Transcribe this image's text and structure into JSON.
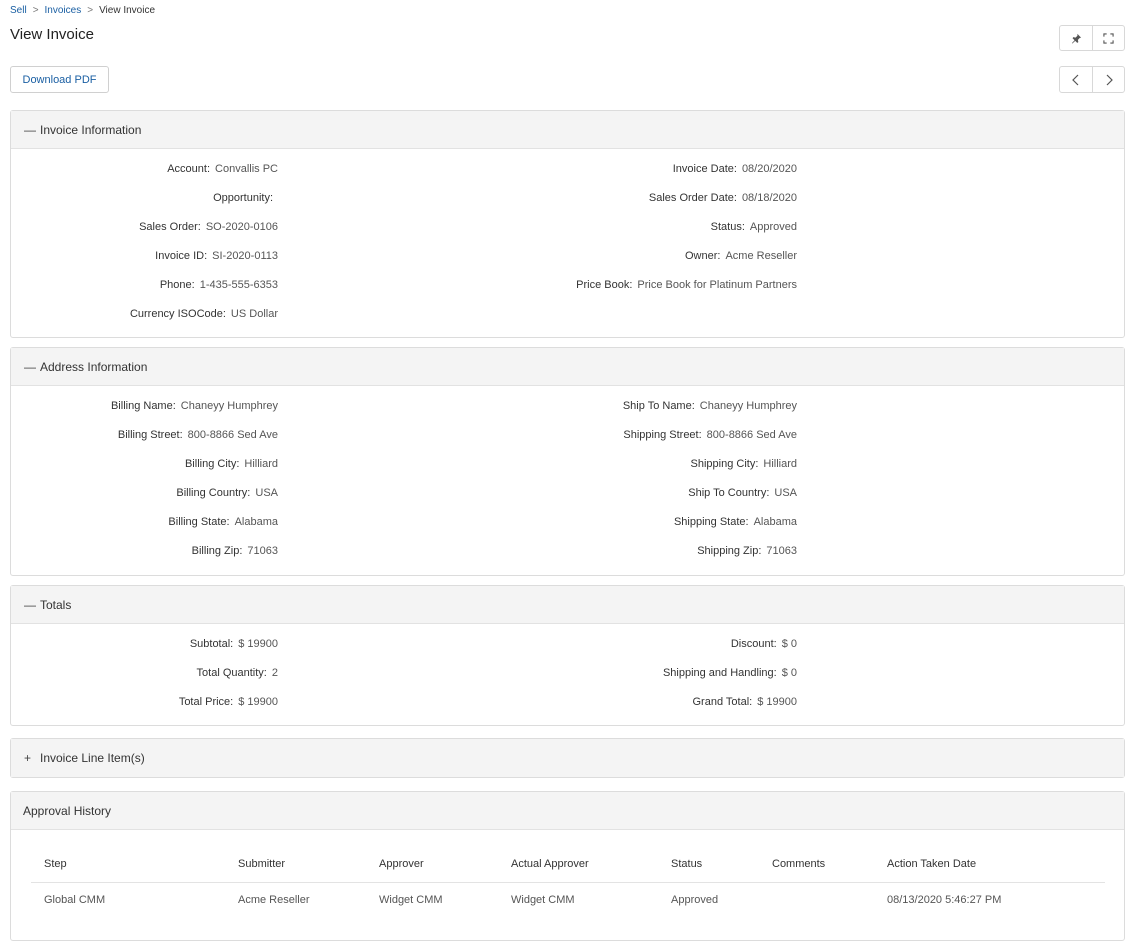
{
  "breadcrumb": {
    "items": [
      "Sell",
      "Invoices"
    ],
    "current": "View Invoice",
    "sep": ">"
  },
  "page_title": "View Invoice",
  "toolbar": {
    "download_label": "Download PDF",
    "pin_icon": "pin-icon",
    "expand_icon": "expand-icon",
    "prev_icon": "chevron-left-icon",
    "next_icon": "chevron-right-icon"
  },
  "sections": {
    "invoice_info": {
      "title": "Invoice Information",
      "toggle": "—",
      "left": [
        {
          "label": "Account:",
          "value": "Convallis PC"
        },
        {
          "label": "Opportunity:",
          "value": ""
        },
        {
          "label": "Sales Order:",
          "value": "SO-2020-0106"
        },
        {
          "label": "Invoice ID:",
          "value": "SI-2020-0113"
        },
        {
          "label": "Phone:",
          "value": "1-435-555-6353"
        },
        {
          "label": "Currency ISOCode:",
          "value": "US Dollar"
        }
      ],
      "right": [
        {
          "label": "Invoice Date:",
          "value": "08/20/2020"
        },
        {
          "label": "Sales Order Date:",
          "value": "08/18/2020"
        },
        {
          "label": "Status:",
          "value": "Approved"
        },
        {
          "label": "Owner:",
          "value": "Acme Reseller"
        },
        {
          "label": "Price Book:",
          "value": "Price Book for Platinum Partners"
        }
      ]
    },
    "address_info": {
      "title": "Address Information",
      "toggle": "—",
      "left": [
        {
          "label": "Billing Name:",
          "value": "Chaneyy Humphrey"
        },
        {
          "label": "Billing Street:",
          "value": "800-8866 Sed Ave"
        },
        {
          "label": "Billing City:",
          "value": "Hilliard"
        },
        {
          "label": "Billing Country:",
          "value": "USA"
        },
        {
          "label": "Billing State:",
          "value": "Alabama"
        },
        {
          "label": "Billing Zip:",
          "value": "71063"
        }
      ],
      "right": [
        {
          "label": "Ship To Name:",
          "value": "Chaneyy Humphrey"
        },
        {
          "label": "Shipping Street:",
          "value": "800-8866 Sed Ave"
        },
        {
          "label": "Shipping City:",
          "value": "Hilliard"
        },
        {
          "label": "Ship To Country:",
          "value": "USA"
        },
        {
          "label": "Shipping State:",
          "value": "Alabama"
        },
        {
          "label": "Shipping Zip:",
          "value": "71063"
        }
      ]
    },
    "totals": {
      "title": "Totals",
      "toggle": "—",
      "left": [
        {
          "label": "Subtotal:",
          "value": "$ 19900"
        },
        {
          "label": "Total Quantity:",
          "value": "2"
        },
        {
          "label": "Total Price:",
          "value": "$ 19900"
        }
      ],
      "right": [
        {
          "label": "Discount:",
          "value": "$ 0"
        },
        {
          "label": "Shipping and Handling:",
          "value": "$ 0"
        },
        {
          "label": "Grand Total:",
          "value": "$ 19900"
        }
      ]
    },
    "line_items": {
      "title": "Invoice Line Item(s)",
      "toggle": "+"
    },
    "approval_history": {
      "title": "Approval History",
      "columns": [
        "Step",
        "Submitter",
        "Approver",
        "Actual Approver",
        "Status",
        "Comments",
        "Action Taken Date"
      ],
      "rows": [
        [
          "Global CMM",
          "Acme Reseller",
          "Widget CMM",
          "Widget CMM",
          "Approved",
          "",
          "08/13/2020 5:46:27 PM"
        ]
      ]
    }
  },
  "colors": {
    "link": "#1a5fa3",
    "header_bg": "#f4f4f4",
    "border": "#dcdcdc"
  }
}
